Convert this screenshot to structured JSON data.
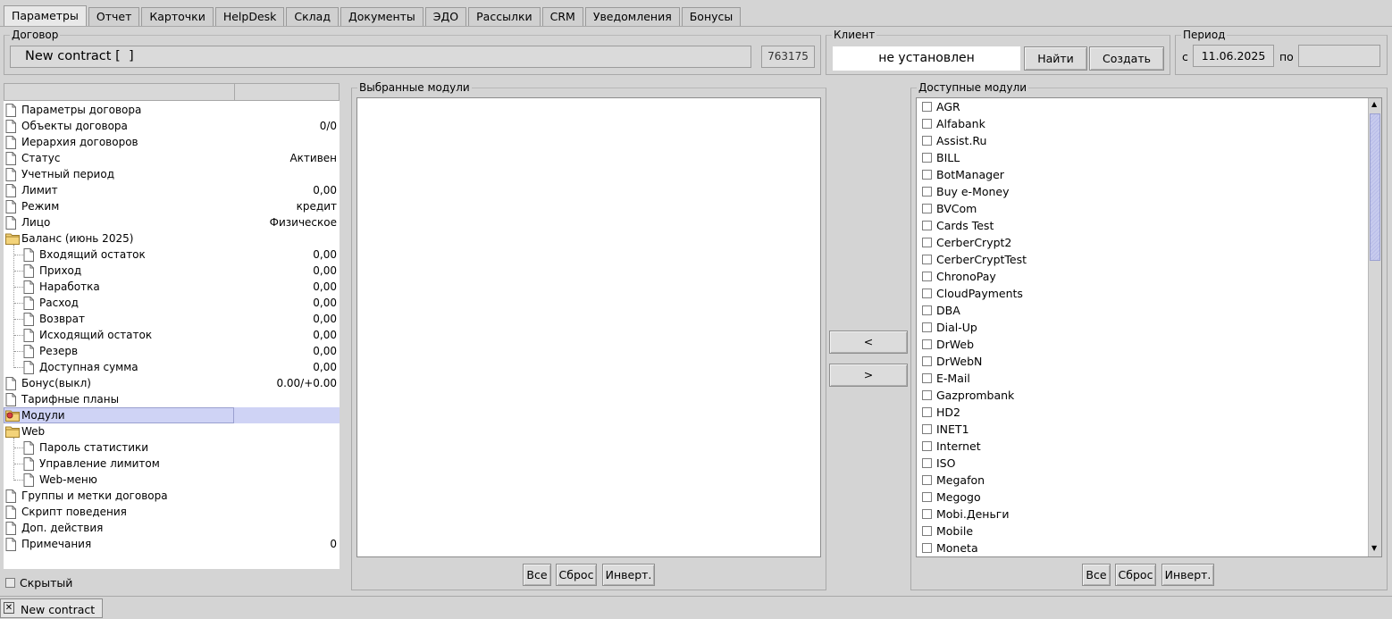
{
  "tabs": [
    "Параметры",
    "Отчет",
    "Карточки",
    "HelpDesk",
    "Склад",
    "Документы",
    "ЭДО",
    "Рассылки",
    "CRM",
    "Уведомления",
    "Бонусы"
  ],
  "contract": {
    "title": "Договор",
    "name": "New contract [  ]",
    "id": "763175"
  },
  "client": {
    "title": "Клиент",
    "value": "не установлен",
    "find_label": "Найти",
    "create_label": "Создать"
  },
  "period": {
    "title": "Период",
    "from_label": "с",
    "from_value": "11.06.2025",
    "to_label": "по",
    "to_value": ""
  },
  "tree": [
    {
      "label": "Параметры договора",
      "value": "",
      "indent": 0,
      "icon": "file"
    },
    {
      "label": "Объекты договора",
      "value": "0/0",
      "indent": 0,
      "icon": "file"
    },
    {
      "label": "Иерархия договоров",
      "value": "",
      "indent": 0,
      "icon": "file"
    },
    {
      "label": "Статус",
      "value": "Активен",
      "indent": 0,
      "icon": "file"
    },
    {
      "label": "Учетный период",
      "value": "",
      "indent": 0,
      "icon": "file"
    },
    {
      "label": "Лимит",
      "value": "0,00",
      "indent": 0,
      "icon": "file"
    },
    {
      "label": "Режим",
      "value": "кредит",
      "indent": 0,
      "icon": "file"
    },
    {
      "label": "Лицо",
      "value": "Физическое",
      "indent": 0,
      "icon": "file"
    },
    {
      "label": "Баланс (июнь 2025)",
      "value": "",
      "indent": 0,
      "icon": "folder"
    },
    {
      "label": "Входящий остаток",
      "value": "0,00",
      "indent": 1,
      "icon": "file"
    },
    {
      "label": "Приход",
      "value": "0,00",
      "indent": 1,
      "icon": "file"
    },
    {
      "label": "Наработка",
      "value": "0,00",
      "indent": 1,
      "icon": "file"
    },
    {
      "label": "Расход",
      "value": "0,00",
      "indent": 1,
      "icon": "file"
    },
    {
      "label": "Возврат",
      "value": "0,00",
      "indent": 1,
      "icon": "file"
    },
    {
      "label": "Исходящий остаток",
      "value": "0,00",
      "indent": 1,
      "icon": "file"
    },
    {
      "label": "Резерв",
      "value": "0,00",
      "indent": 1,
      "icon": "file"
    },
    {
      "label": "Доступная сумма",
      "value": "0,00",
      "indent": 1,
      "icon": "file"
    },
    {
      "label": "Бонус(выкл)",
      "value": "0.00/+0.00",
      "indent": 0,
      "icon": "file"
    },
    {
      "label": "Тарифные планы",
      "value": "",
      "indent": 0,
      "icon": "file"
    },
    {
      "label": "Модули",
      "value": "",
      "indent": 0,
      "icon": "folder-star",
      "selected": true
    },
    {
      "label": "Web",
      "value": "",
      "indent": 0,
      "icon": "folder"
    },
    {
      "label": "Пароль статистики",
      "value": "",
      "indent": 1,
      "icon": "file"
    },
    {
      "label": "Управление лимитом",
      "value": "",
      "indent": 1,
      "icon": "file"
    },
    {
      "label": "Web-меню",
      "value": "",
      "indent": 1,
      "icon": "file"
    },
    {
      "label": "Группы и метки договора",
      "value": "",
      "indent": 0,
      "icon": "file"
    },
    {
      "label": "Скрипт поведения",
      "value": "",
      "indent": 0,
      "icon": "file"
    },
    {
      "label": "Доп. действия",
      "value": "",
      "indent": 0,
      "icon": "file"
    },
    {
      "label": "Примечания",
      "value": "0",
      "indent": 0,
      "icon": "file"
    }
  ],
  "hidden_label": "Скрытый",
  "selected_modules": {
    "title": "Выбранные модули",
    "items": []
  },
  "available_modules": {
    "title": "Доступные модули",
    "items": [
      "AGR",
      "Alfabank",
      "Assist.Ru",
      "BILL",
      "BotManager",
      "Buy e-Money",
      "BVCom",
      "Cards Test",
      "CerberCrypt2",
      "CerberCryptTest",
      "ChronoPay",
      "CloudPayments",
      "DBA",
      "Dial-Up",
      "DrWeb",
      "DrWebN",
      "E-Mail",
      "Gazprombank",
      "HD2",
      "INET1",
      "Internet",
      "ISO",
      "Megafon",
      "Megogo",
      "Mobi.Деньги",
      "Mobile",
      "Moneta"
    ]
  },
  "list_buttons": {
    "all": "Все",
    "reset": "Сброс",
    "invert": "Инверт."
  },
  "move_left_label": "<",
  "move_right_label": ">",
  "bottom_tab": {
    "label": "New contract",
    "close": "✕"
  }
}
